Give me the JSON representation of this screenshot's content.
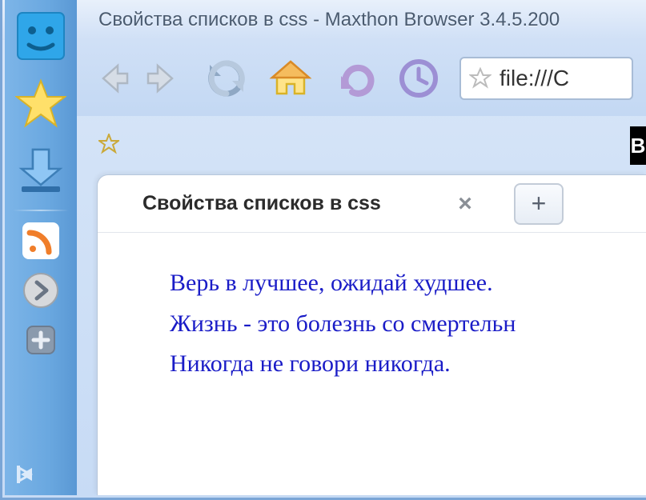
{
  "window": {
    "title": "Свойства списков в css - Maxthon Browser 3.4.5.200"
  },
  "toolbar": {
    "back_icon": "back-icon",
    "forward_icon": "forward-icon",
    "refresh_icon": "refresh-icon",
    "home_icon": "home-icon",
    "undo_icon": "undo-icon",
    "history_icon": "history-icon"
  },
  "address": {
    "url": "file:///C"
  },
  "favbar": {
    "right_letter": "B"
  },
  "tabs": {
    "active": {
      "label": "Свойства списков в css"
    },
    "newtab_symbol": "+"
  },
  "page": {
    "lines": [
      "Верь в лучшее, ожидай худшее.",
      "Жизнь - это болезнь со смертельн",
      "Никогда не говори никогда."
    ]
  },
  "sidebar": {
    "items": [
      {
        "name": "account-icon"
      },
      {
        "name": "favorites-icon"
      },
      {
        "name": "downloads-icon"
      },
      {
        "name": "rss-icon"
      },
      {
        "name": "expand-icon"
      },
      {
        "name": "add-icon"
      }
    ]
  }
}
